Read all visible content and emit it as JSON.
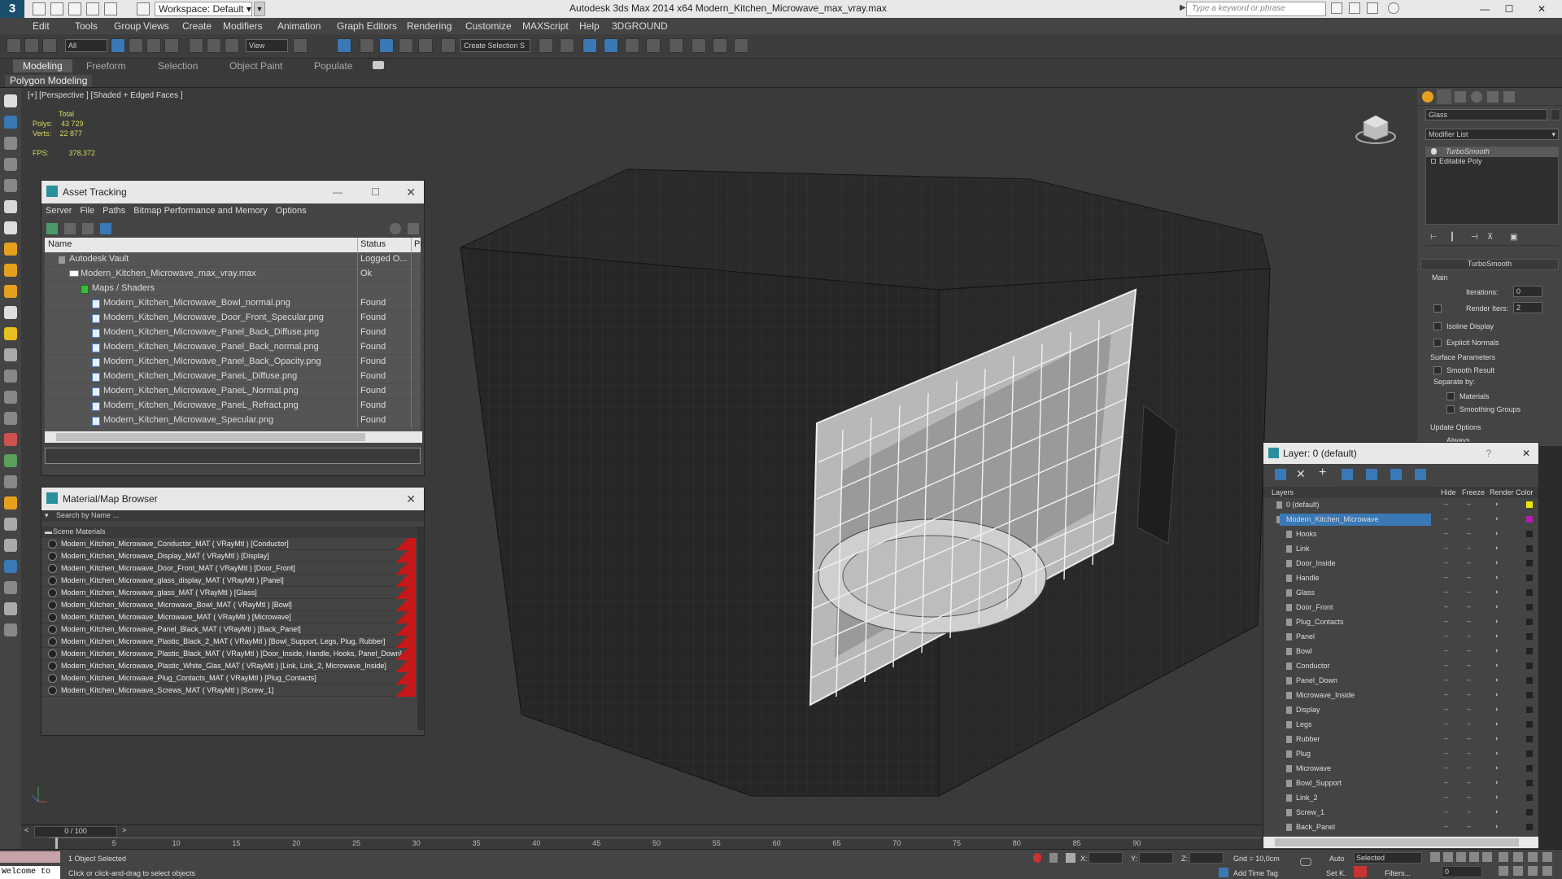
{
  "titlebar": {
    "workspace_label": "Workspace: Default",
    "title": "Autodesk 3ds Max  2014 x64      Modern_Kitchen_Microwave_max_vray.max",
    "search_placeholder": "Type a keyword or phrase",
    "min": "—",
    "max": "☐",
    "close": "✕"
  },
  "menu": [
    "Edit",
    "Tools",
    "Group",
    "Views",
    "Create",
    "Modifiers",
    "Animation",
    "Graph Editors",
    "Rendering",
    "Customize",
    "MAXScript",
    "Help",
    "3DGROUND"
  ],
  "toolbar": {
    "filter_value": "All",
    "view_value": "View",
    "selection_set": "Create Selection S"
  },
  "ribbon": {
    "tabs": [
      "Modeling",
      "Freeform",
      "Selection",
      "Object Paint",
      "Populate"
    ],
    "active_tab": "Modeling",
    "sub_label": "Polygon Modeling"
  },
  "viewport": {
    "label": "[+] [Perspective ] [Shaded + Edged Faces ]",
    "stats": {
      "total_label": "Total",
      "polys_label": "Polys:",
      "polys": "43 729",
      "verts_label": "Verts:",
      "verts": "22 877",
      "fps_label": "FPS:",
      "fps": "378,372"
    }
  },
  "asset_tracking": {
    "title": "Asset Tracking",
    "menu": [
      "Server",
      "File",
      "Paths",
      "Bitmap Performance and Memory",
      "Options"
    ],
    "columns": {
      "name": "Name",
      "status": "Status",
      "extra": "Pr"
    },
    "rows": [
      {
        "name": "Autodesk Vault",
        "status": "Logged O...",
        "indent": 0,
        "kind": "vault"
      },
      {
        "name": "Modern_Kitchen_Microwave_max_vray.max",
        "status": "Ok",
        "indent": 1,
        "kind": "max"
      },
      {
        "name": "Maps / Shaders",
        "status": "",
        "indent": 2,
        "kind": "folder"
      },
      {
        "name": "Modern_Kitchen_Microwave_Bowl_normal.png",
        "status": "Found",
        "indent": 3,
        "kind": "file"
      },
      {
        "name": "Modern_Kitchen_Microwave_Door_Front_Specular.png",
        "status": "Found",
        "indent": 3,
        "kind": "file"
      },
      {
        "name": "Modern_Kitchen_Microwave_Panel_Back_Diffuse.png",
        "status": "Found",
        "indent": 3,
        "kind": "file"
      },
      {
        "name": "Modern_Kitchen_Microwave_Panel_Back_normal.png",
        "status": "Found",
        "indent": 3,
        "kind": "file"
      },
      {
        "name": "Modern_Kitchen_Microwave_Panel_Back_Opacity.png",
        "status": "Found",
        "indent": 3,
        "kind": "file"
      },
      {
        "name": "Modern_Kitchen_Microwave_PaneL_Diffuse.png",
        "status": "Found",
        "indent": 3,
        "kind": "file"
      },
      {
        "name": "Modern_Kitchen_Microwave_PaneL_Normal.png",
        "status": "Found",
        "indent": 3,
        "kind": "file"
      },
      {
        "name": "Modern_Kitchen_Microwave_PaneL_Refract.png",
        "status": "Found",
        "indent": 3,
        "kind": "file"
      },
      {
        "name": "Modern_Kitchen_Microwave_Specular.png",
        "status": "Found",
        "indent": 3,
        "kind": "file"
      }
    ]
  },
  "material_browser": {
    "title": "Material/Map Browser",
    "search_placeholder": "Search by Name ...",
    "group": "Scene Materials",
    "items": [
      "Modern_Kitchen_Microwave_Conductor_MAT  ( VRayMtl )  [Conductor]",
      "Modern_Kitchen_Microwave_Display_MAT  ( VRayMtl )  [Display]",
      "Modern_Kitchen_Microwave_Door_Front_MAT  ( VRayMtl )  [Door_Front]",
      "Modern_Kitchen_Microwave_glass_display_MAT  ( VRayMtl )  [Panel]",
      "Modern_Kitchen_Microwave_glass_MAT  ( VRayMtl )  [Glass]",
      "Modern_Kitchen_Microwave_Microwave_Bowl_MAT  ( VRayMtl )  [Bowl]",
      "Modern_Kitchen_Microwave_Microwave_MAT  ( VRayMtl )  [Microwave]",
      "Modern_Kitchen_Microwave_Panel_Black_MAT  ( VRayMtl )  [Back_Panel]",
      "Modern_Kitchen_Microwave_Plastic_Black_2_MAT  ( VRayMtl )  [Bowl_Support, Legs, Plug, Rubber]",
      "Modern_Kitchen_Microwave_Plastic_Black_MAT  ( VRayMtl )  [Door_Inside, Handle, Hooks, Panel_Down]",
      "Modern_Kitchen_Microwave_Plastic_White_Glas_MAT  ( VRayMtl )  [Link, Link_2, Microwave_Inside]",
      "Modern_Kitchen_Microwave_Plug_Contacts_MAT  ( VRayMtl )  [Plug_Contacts]",
      "Modern_Kitchen_Microwave_Screws_MAT  ( VRayMtl )  [Screw_1]"
    ]
  },
  "command_panel": {
    "object_name": "Glass",
    "modifier_list": "Modifier List",
    "stack": [
      "TurboSmooth",
      "Editable Poly"
    ],
    "rollout_title": "TurboSmooth",
    "main_label": "Main",
    "iterations_label": "Iterations:",
    "iterations": "0",
    "render_iters_label": "Render Iters:",
    "render_iters": "2",
    "isoline": "Isoline Display",
    "explicit": "Explicit Normals",
    "surface_params": "Surface Parameters",
    "smooth_result": "Smooth Result",
    "separate_by": "Separate by:",
    "materials": "Materials",
    "smoothing_groups": "Smoothing Groups",
    "update_options": "Update Options",
    "always": "Always"
  },
  "layer_panel": {
    "title": "Layer: 0 (default)",
    "help": "?",
    "columns": {
      "layers": "Layers",
      "hide": "Hide",
      "freeze": "Freeze",
      "render": "Render",
      "color": "Color"
    },
    "default_layer": "0 (default)",
    "selected_layer": "Modern_Kitchen_Microwave",
    "children": [
      "Hooks",
      "Link",
      "Door_Inside",
      "Handle",
      "Glass",
      "Door_Front",
      "Plug_Contacts",
      "Panel",
      "Bowl",
      "Conductor",
      "Panel_Down",
      "Microwave_Inside",
      "Display",
      "Legs",
      "Rubber",
      "Plug",
      "Microwave",
      "Bowl_Support",
      "Link_2",
      "Screw_1",
      "Back_Panel"
    ],
    "colors": {
      "default": "#e8e800",
      "selected": "#b020b0",
      "child": "#222222"
    }
  },
  "timeline": {
    "frame_readout": "0 / 100",
    "ticks": [
      "5",
      "10",
      "15",
      "20",
      "25",
      "30",
      "35",
      "40",
      "45",
      "50",
      "55",
      "60",
      "65",
      "70",
      "75",
      "80",
      "85",
      "90"
    ]
  },
  "status": {
    "welcome": "Welcome to",
    "selected": "1 Object Selected",
    "prompt": "Click or click-and-drag to select objects",
    "x_label": "X:",
    "y_label": "Y:",
    "z_label": "Z:",
    "grid": "Grid = 10,0cm",
    "add_time_tag": "Add Time Tag",
    "auto": "Auto",
    "selected_dd": "Selected",
    "set_k": "Set K.",
    "filters": "Filters...",
    "frame": "0"
  },
  "colors": {
    "accent": "#3a78b6",
    "found_red": "#c61818",
    "stats_yellow": "#d8d85a"
  }
}
